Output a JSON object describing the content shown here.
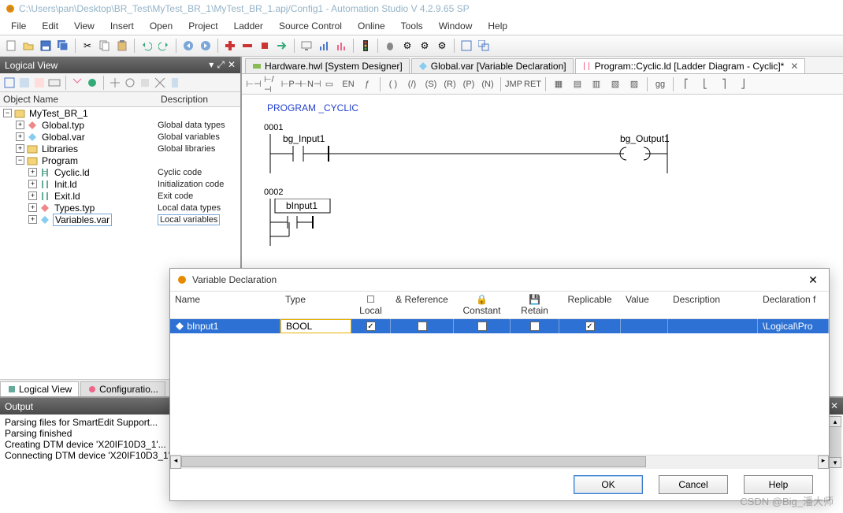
{
  "title": "C:\\Users\\pan\\Desktop\\BR_Test\\MyTest_BR_1\\MyTest_BR_1.apj/Config1 - Automation Studio V 4.2.9.65 SP",
  "menu": [
    "File",
    "Edit",
    "View",
    "Insert",
    "Open",
    "Project",
    "Ladder",
    "Source Control",
    "Online",
    "Tools",
    "Window",
    "Help"
  ],
  "logical_view": {
    "title": "Logical View",
    "col_object": "Object Name",
    "col_desc": "Description",
    "root": "MyTest_BR_1",
    "items": [
      {
        "label": "Global.typ",
        "desc": "Global data types"
      },
      {
        "label": "Global.var",
        "desc": "Global variables"
      },
      {
        "label": "Libraries",
        "desc": "Global libraries"
      },
      {
        "label": "Program",
        "desc": ""
      }
    ],
    "program_children": [
      {
        "label": "Cyclic.ld",
        "desc": "Cyclic code"
      },
      {
        "label": "Init.ld",
        "desc": "Initialization code"
      },
      {
        "label": "Exit.ld",
        "desc": "Exit code"
      },
      {
        "label": "Types.typ",
        "desc": "Local data types"
      },
      {
        "label": "Variables.var",
        "desc": "Local variables"
      }
    ]
  },
  "bottom_tabs": {
    "logical": "Logical View",
    "config": "Configuratio..."
  },
  "doc_tabs": [
    {
      "label": "Hardware.hwl [System Designer]"
    },
    {
      "label": "Global.var [Variable Declaration]"
    },
    {
      "label": "Program::Cyclic.ld [Ladder Diagram - Cyclic]*"
    }
  ],
  "ladder": {
    "program_header": "PROGRAM _CYCLIC",
    "rungs": [
      {
        "num": "0001",
        "contact": "bg_Input1",
        "coil": "bg_Output1"
      },
      {
        "num": "0002",
        "block": "bInput1"
      }
    ]
  },
  "output": {
    "title": "Output",
    "lines": [
      "Parsing files for SmartEdit Support...",
      "Parsing finished",
      "Creating DTM device 'X20IF10D3_1'...",
      "Connecting DTM device 'X20IF10D3_1'..."
    ]
  },
  "dialog": {
    "title": "Variable Declaration",
    "headers": {
      "name": "Name",
      "type": "Type",
      "local": "Local",
      "ref": "& Reference",
      "const": "Constant",
      "retain": "Retain",
      "rep": "Replicable",
      "value": "Value",
      "desc": "Description",
      "decl": "Declaration f"
    },
    "row": {
      "name": "bInput1",
      "type": "BOOL",
      "local": true,
      "ref": false,
      "const": false,
      "retain": false,
      "rep": true,
      "value": "",
      "desc": "",
      "decl": "\\Logical\\Pro"
    },
    "buttons": {
      "ok": "OK",
      "cancel": "Cancel",
      "help": "Help"
    }
  },
  "watermark": "CSDN @Big_潘大师"
}
